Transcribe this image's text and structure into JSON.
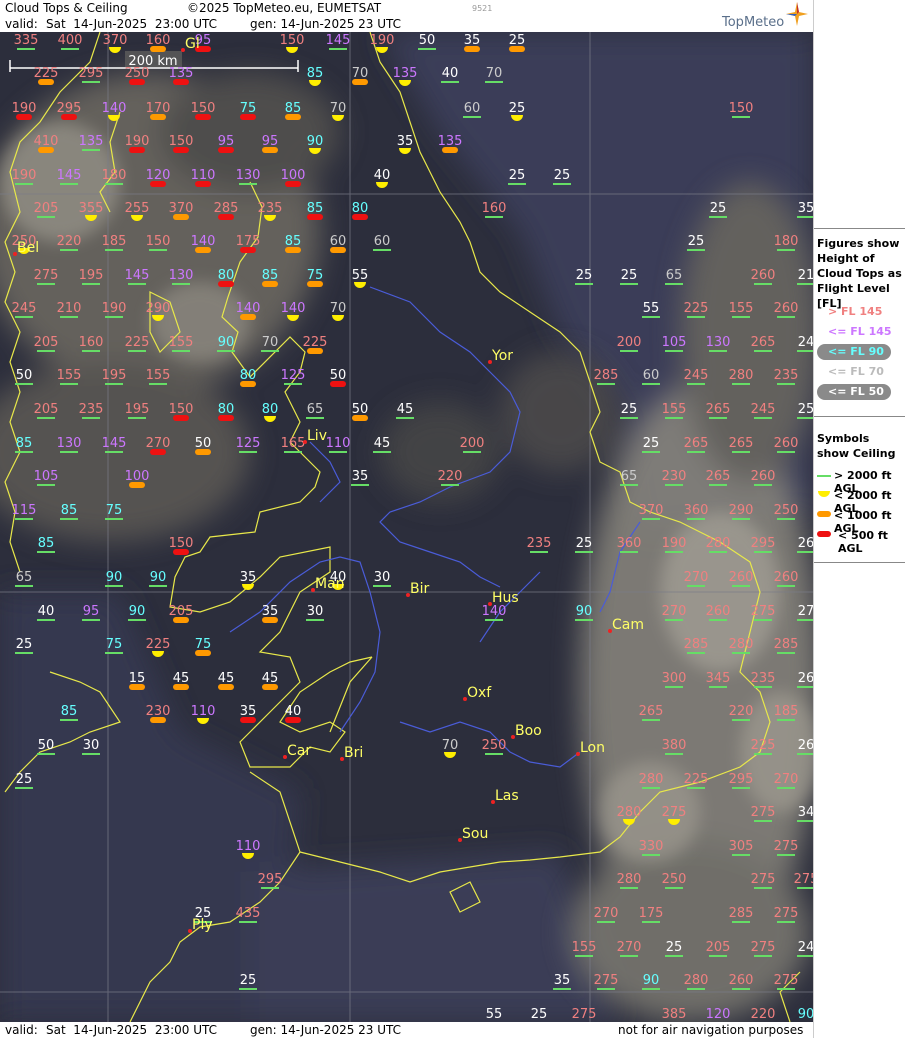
{
  "header": {
    "title": "Cloud Tops & Ceiling",
    "copyright": "©2025 TopMeteo.eu, EUMETSAT",
    "valid_label": "valid:",
    "valid_value": "Sat  14-Jun-2025  23:00 UTC",
    "gen_label": "gen: 14-Jun-2025 23 UTC",
    "tiny_id": "9521",
    "logo": "TopMeteo"
  },
  "footer": {
    "valid_label": "valid:",
    "valid_value": "Sat  14-Jun-2025  23:00 UTC",
    "gen_label": "gen: 14-Jun-2025 23 UTC",
    "disclaimer": "not for air navigation purposes"
  },
  "scale": {
    "label": "200 km"
  },
  "legend": {
    "tops_title": "Figures show Height of Cloud Tops as Flight Level  [FL]",
    "tops_items": [
      {
        "label": "> FL 145",
        "color": "#f08080"
      },
      {
        "label": "<= FL 145",
        "color": "#cc77ff"
      },
      {
        "label": "<= FL 90",
        "color": "#66ffff"
      },
      {
        "label": "<= FL 70",
        "color": "#bbbbbb"
      },
      {
        "label": "<= FL 50",
        "color": "#ffffff"
      }
    ],
    "ceiling_title": "Symbols show Ceiling",
    "ceiling_items": [
      {
        "label": "> 2000 ft AGL",
        "color": "#66dd66"
      },
      {
        "label": "< 2000 ft AGL",
        "color": "#ffee00"
      },
      {
        "label": "< 1000 ft AGL",
        "color": "#ff9900"
      },
      {
        "label": "< 500 ft AGL",
        "color": "#ee1111"
      }
    ]
  },
  "cities": [
    "Yor",
    "Liv",
    "Man",
    "Bir",
    "Hus",
    "Cam",
    "Oxf",
    "Boo",
    "Lon",
    "Car",
    "Bri",
    "Las",
    "Sou",
    "Ply",
    "Gl",
    "Bel"
  ],
  "stations": [
    {
      "v": "335",
      "t": "p",
      "c": "g"
    },
    {
      "v": "400",
      "t": "p",
      "c": "g"
    },
    {
      "v": "370",
      "t": "p",
      "c": "y"
    },
    {
      "v": "160",
      "t": "p",
      "c": "o"
    },
    {
      "v": "95",
      "t": "v",
      "c": "r"
    },
    {
      "v": "150",
      "t": "p",
      "c": "y"
    },
    {
      "v": "145",
      "t": "v",
      "c": "g"
    },
    {
      "v": "190",
      "t": "p",
      "c": "y"
    },
    {
      "v": "50",
      "t": "w",
      "c": "g"
    },
    {
      "v": "35",
      "t": "w",
      "c": "o"
    },
    {
      "v": "25",
      "t": "w",
      "c": "o"
    },
    {
      "v": "225",
      "t": "p",
      "c": "o"
    },
    {
      "v": "295",
      "t": "p",
      "c": "g"
    },
    {
      "v": "250",
      "t": "p",
      "c": "r"
    },
    {
      "v": "135",
      "t": "v",
      "c": "r"
    },
    {
      "v": "85",
      "t": "c",
      "c": "y"
    },
    {
      "v": "70",
      "t": "l",
      "c": "o"
    },
    {
      "v": "135",
      "t": "v",
      "c": "y"
    },
    {
      "v": "40",
      "t": "w",
      "c": "g"
    },
    {
      "v": "70",
      "t": "l",
      "c": "g"
    },
    {
      "v": "190",
      "t": "p",
      "c": "r"
    },
    {
      "v": "295",
      "t": "p",
      "c": "r"
    },
    {
      "v": "140",
      "t": "v",
      "c": "y"
    },
    {
      "v": "170",
      "t": "p",
      "c": "o"
    },
    {
      "v": "150",
      "t": "p",
      "c": "r"
    },
    {
      "v": "75",
      "t": "c",
      "c": "r"
    },
    {
      "v": "85",
      "t": "c",
      "c": "o"
    },
    {
      "v": "70",
      "t": "l",
      "c": "y"
    },
    {
      "v": "60",
      "t": "l",
      "c": "g"
    },
    {
      "v": "25",
      "t": "w",
      "c": "y"
    },
    {
      "v": "150",
      "t": "p",
      "c": "g"
    },
    {
      "v": "410",
      "t": "p",
      "c": "o"
    },
    {
      "v": "135",
      "t": "v",
      "c": "g"
    },
    {
      "v": "190",
      "t": "p",
      "c": "r"
    },
    {
      "v": "150",
      "t": "p",
      "c": "r"
    },
    {
      "v": "95",
      "t": "v",
      "c": "r"
    },
    {
      "v": "95",
      "t": "v",
      "c": "o"
    },
    {
      "v": "90",
      "t": "c",
      "c": "y"
    },
    {
      "v": "35",
      "t": "w",
      "c": "y"
    },
    {
      "v": "135",
      "t": "v",
      "c": "o"
    },
    {
      "v": "190",
      "t": "p",
      "c": "g"
    },
    {
      "v": "145",
      "t": "v",
      "c": "g"
    },
    {
      "v": "180",
      "t": "p",
      "c": "g"
    },
    {
      "v": "120",
      "t": "v",
      "c": "r"
    },
    {
      "v": "110",
      "t": "v",
      "c": "r"
    },
    {
      "v": "130",
      "t": "v",
      "c": "g"
    },
    {
      "v": "100",
      "t": "v",
      "c": "r"
    },
    {
      "v": "40",
      "t": "w",
      "c": "y"
    },
    {
      "v": "25",
      "t": "w",
      "c": "g"
    },
    {
      "v": "25",
      "t": "w",
      "c": "g"
    },
    {
      "v": "205",
      "t": "p",
      "c": "g"
    },
    {
      "v": "355",
      "t": "p",
      "c": "y"
    },
    {
      "v": "255",
      "t": "p",
      "c": "y"
    },
    {
      "v": "370",
      "t": "p",
      "c": "o"
    },
    {
      "v": "285",
      "t": "p",
      "c": "r"
    },
    {
      "v": "235",
      "t": "p",
      "c": "y"
    },
    {
      "v": "85",
      "t": "c",
      "c": "r"
    },
    {
      "v": "80",
      "t": "c",
      "c": "r"
    },
    {
      "v": "160",
      "t": "p",
      "c": "g"
    },
    {
      "v": "25",
      "t": "w",
      "c": "g"
    },
    {
      "v": "35",
      "t": "w",
      "c": "g"
    },
    {
      "v": "250",
      "t": "p",
      "c": "y"
    },
    {
      "v": "220",
      "t": "p",
      "c": "g"
    },
    {
      "v": "185",
      "t": "p",
      "c": "g"
    },
    {
      "v": "150",
      "t": "p",
      "c": "g"
    },
    {
      "v": "140",
      "t": "v",
      "c": "o"
    },
    {
      "v": "175",
      "t": "p",
      "c": "r"
    },
    {
      "v": "85",
      "t": "c",
      "c": "o"
    },
    {
      "v": "60",
      "t": "l",
      "c": "o"
    },
    {
      "v": "60",
      "t": "l",
      "c": "g"
    },
    {
      "v": "25",
      "t": "w",
      "c": "g"
    },
    {
      "v": "180",
      "t": "p",
      "c": "g"
    },
    {
      "v": "275",
      "t": "p",
      "c": "g"
    },
    {
      "v": "195",
      "t": "p",
      "c": "g"
    },
    {
      "v": "145",
      "t": "v",
      "c": "g"
    },
    {
      "v": "130",
      "t": "v",
      "c": "g"
    },
    {
      "v": "80",
      "t": "c",
      "c": "r"
    },
    {
      "v": "85",
      "t": "c",
      "c": "o"
    },
    {
      "v": "75",
      "t": "c",
      "c": "o"
    },
    {
      "v": "55",
      "t": "w",
      "c": "y"
    },
    {
      "v": "25",
      "t": "w",
      "c": "g"
    },
    {
      "v": "25",
      "t": "w",
      "c": "g"
    },
    {
      "v": "65",
      "t": "l",
      "c": "g"
    },
    {
      "v": "260",
      "t": "p",
      "c": "g"
    },
    {
      "v": "21",
      "t": "w",
      "c": "g"
    },
    {
      "v": "245",
      "t": "p",
      "c": "g"
    },
    {
      "v": "210",
      "t": "p",
      "c": "g"
    },
    {
      "v": "190",
      "t": "p",
      "c": "g"
    },
    {
      "v": "290",
      "t": "p",
      "c": "y"
    },
    {
      "v": "140",
      "t": "v",
      "c": "o"
    },
    {
      "v": "140",
      "t": "v",
      "c": "y"
    },
    {
      "v": "70",
      "t": "l",
      "c": "y"
    },
    {
      "v": "55",
      "t": "w",
      "c": "g"
    },
    {
      "v": "225",
      "t": "p",
      "c": "g"
    },
    {
      "v": "155",
      "t": "p",
      "c": "g"
    },
    {
      "v": "260",
      "t": "p",
      "c": "g"
    },
    {
      "v": "205",
      "t": "p",
      "c": "g"
    },
    {
      "v": "160",
      "t": "p",
      "c": "g"
    },
    {
      "v": "225",
      "t": "p",
      "c": "g"
    },
    {
      "v": "155",
      "t": "p",
      "c": "g"
    },
    {
      "v": "90",
      "t": "c",
      "c": "g"
    },
    {
      "v": "70",
      "t": "l",
      "c": "g"
    },
    {
      "v": "225",
      "t": "p",
      "c": "o"
    },
    {
      "v": "200",
      "t": "p",
      "c": "g"
    },
    {
      "v": "105",
      "t": "v",
      "c": "g"
    },
    {
      "v": "130",
      "t": "v",
      "c": "g"
    },
    {
      "v": "265",
      "t": "p",
      "c": "g"
    },
    {
      "v": "24",
      "t": "w",
      "c": "g"
    },
    {
      "v": "50",
      "t": "w",
      "c": "g"
    },
    {
      "v": "155",
      "t": "p",
      "c": "g"
    },
    {
      "v": "195",
      "t": "p",
      "c": "g"
    },
    {
      "v": "155",
      "t": "p",
      "c": "g"
    },
    {
      "v": "80",
      "t": "c",
      "c": "o"
    },
    {
      "v": "125",
      "t": "v",
      "c": "g"
    },
    {
      "v": "50",
      "t": "w",
      "c": "r"
    },
    {
      "v": "285",
      "t": "p",
      "c": "g"
    },
    {
      "v": "60",
      "t": "l",
      "c": "g"
    },
    {
      "v": "245",
      "t": "p",
      "c": "g"
    },
    {
      "v": "280",
      "t": "p",
      "c": "g"
    },
    {
      "v": "235",
      "t": "p",
      "c": "g"
    },
    {
      "v": "205",
      "t": "p",
      "c": "g"
    },
    {
      "v": "235",
      "t": "p",
      "c": "g"
    },
    {
      "v": "195",
      "t": "p",
      "c": "g"
    },
    {
      "v": "150",
      "t": "p",
      "c": "r"
    },
    {
      "v": "80",
      "t": "c",
      "c": "r"
    },
    {
      "v": "80",
      "t": "c",
      "c": "y"
    },
    {
      "v": "65",
      "t": "l",
      "c": "g"
    },
    {
      "v": "50",
      "t": "w",
      "c": "o"
    },
    {
      "v": "45",
      "t": "w",
      "c": "g"
    },
    {
      "v": "25",
      "t": "w",
      "c": "g"
    },
    {
      "v": "155",
      "t": "p",
      "c": "g"
    },
    {
      "v": "265",
      "t": "p",
      "c": "g"
    },
    {
      "v": "245",
      "t": "p",
      "c": "g"
    },
    {
      "v": "25",
      "t": "w",
      "c": "g"
    },
    {
      "v": "85",
      "t": "c",
      "c": "g"
    },
    {
      "v": "130",
      "t": "v",
      "c": "g"
    },
    {
      "v": "145",
      "t": "v",
      "c": "g"
    },
    {
      "v": "270",
      "t": "p",
      "c": "r"
    },
    {
      "v": "50",
      "t": "w",
      "c": "o"
    },
    {
      "v": "125",
      "t": "v",
      "c": "g"
    },
    {
      "v": "165",
      "t": "p",
      "c": "g"
    },
    {
      "v": "110",
      "t": "v",
      "c": "g"
    },
    {
      "v": "45",
      "t": "w",
      "c": "g"
    },
    {
      "v": "200",
      "t": "p",
      "c": "g"
    },
    {
      "v": "25",
      "t": "w",
      "c": "g"
    },
    {
      "v": "265",
      "t": "p",
      "c": "g"
    },
    {
      "v": "265",
      "t": "p",
      "c": "g"
    },
    {
      "v": "260",
      "t": "p",
      "c": "g"
    },
    {
      "v": "105",
      "t": "v",
      "c": "g"
    },
    {
      "v": "100",
      "t": "v",
      "c": "o"
    },
    {
      "v": "35",
      "t": "w",
      "c": "g"
    },
    {
      "v": "220",
      "t": "p",
      "c": "g"
    },
    {
      "v": "65",
      "t": "l",
      "c": "g"
    },
    {
      "v": "230",
      "t": "p",
      "c": "g"
    },
    {
      "v": "265",
      "t": "p",
      "c": "g"
    },
    {
      "v": "260",
      "t": "p",
      "c": "g"
    },
    {
      "v": "115",
      "t": "v",
      "c": "g"
    },
    {
      "v": "85",
      "t": "c",
      "c": "g"
    },
    {
      "v": "75",
      "t": "c",
      "c": "g"
    },
    {
      "v": "370",
      "t": "p",
      "c": "g"
    },
    {
      "v": "360",
      "t": "p",
      "c": "g"
    },
    {
      "v": "290",
      "t": "p",
      "c": "g"
    },
    {
      "v": "250",
      "t": "p",
      "c": "g"
    },
    {
      "v": "85",
      "t": "c",
      "c": "g"
    },
    {
      "v": "150",
      "t": "p",
      "c": "r"
    },
    {
      "v": "235",
      "t": "p",
      "c": "g"
    },
    {
      "v": "25",
      "t": "w",
      "c": "g"
    },
    {
      "v": "360",
      "t": "p",
      "c": "g"
    },
    {
      "v": "190",
      "t": "p",
      "c": "g"
    },
    {
      "v": "280",
      "t": "p",
      "c": "g"
    },
    {
      "v": "295",
      "t": "p",
      "c": "g"
    },
    {
      "v": "26",
      "t": "w",
      "c": "g"
    },
    {
      "v": "65",
      "t": "l",
      "c": "g"
    },
    {
      "v": "90",
      "t": "c",
      "c": "g"
    },
    {
      "v": "90",
      "t": "c",
      "c": "g"
    },
    {
      "v": "35",
      "t": "w",
      "c": "y"
    },
    {
      "v": "40",
      "t": "w",
      "c": "y"
    },
    {
      "v": "30",
      "t": "w",
      "c": "g"
    },
    {
      "v": "270",
      "t": "p",
      "c": "g"
    },
    {
      "v": "260",
      "t": "p",
      "c": "g"
    },
    {
      "v": "260",
      "t": "p",
      "c": "g"
    },
    {
      "v": "40",
      "t": "w",
      "c": "g"
    },
    {
      "v": "95",
      "t": "v",
      "c": "g"
    },
    {
      "v": "90",
      "t": "c",
      "c": "g"
    },
    {
      "v": "205",
      "t": "p",
      "c": "o"
    },
    {
      "v": "35",
      "t": "w",
      "c": "o"
    },
    {
      "v": "30",
      "t": "w",
      "c": "g"
    },
    {
      "v": "140",
      "t": "v",
      "c": "g"
    },
    {
      "v": "90",
      "t": "c",
      "c": "g"
    },
    {
      "v": "270",
      "t": "p",
      "c": "g"
    },
    {
      "v": "260",
      "t": "p",
      "c": "g"
    },
    {
      "v": "275",
      "t": "p",
      "c": "g"
    },
    {
      "v": "27",
      "t": "w",
      "c": "g"
    },
    {
      "v": "25",
      "t": "w",
      "c": "g"
    },
    {
      "v": "75",
      "t": "c",
      "c": "g"
    },
    {
      "v": "225",
      "t": "p",
      "c": "y"
    },
    {
      "v": "75",
      "t": "c",
      "c": "o"
    },
    {
      "v": "285",
      "t": "p",
      "c": "g"
    },
    {
      "v": "280",
      "t": "p",
      "c": "g"
    },
    {
      "v": "285",
      "t": "p",
      "c": "g"
    },
    {
      "v": "15",
      "t": "w",
      "c": "o"
    },
    {
      "v": "45",
      "t": "w",
      "c": "o"
    },
    {
      "v": "45",
      "t": "w",
      "c": "o"
    },
    {
      "v": "45",
      "t": "w",
      "c": "o"
    },
    {
      "v": "300",
      "t": "p",
      "c": "g"
    },
    {
      "v": "345",
      "t": "p",
      "c": "g"
    },
    {
      "v": "235",
      "t": "p",
      "c": "g"
    },
    {
      "v": "26",
      "t": "w",
      "c": "g"
    },
    {
      "v": "85",
      "t": "c",
      "c": "g"
    },
    {
      "v": "230",
      "t": "p",
      "c": "o"
    },
    {
      "v": "110",
      "t": "v",
      "c": "y"
    },
    {
      "v": "35",
      "t": "w",
      "c": "r"
    },
    {
      "v": "40",
      "t": "w",
      "c": "r"
    },
    {
      "v": "265",
      "t": "p",
      "c": "g"
    },
    {
      "v": "220",
      "t": "p",
      "c": "g"
    },
    {
      "v": "185",
      "t": "p",
      "c": "g"
    },
    {
      "v": "50",
      "t": "w",
      "c": "g"
    },
    {
      "v": "30",
      "t": "w",
      "c": "g"
    },
    {
      "v": "70",
      "t": "l",
      "c": "y"
    },
    {
      "v": "250",
      "t": "p",
      "c": "g"
    },
    {
      "v": "380",
      "t": "p",
      "c": "g"
    },
    {
      "v": "225",
      "t": "p",
      "c": "g"
    },
    {
      "v": "26",
      "t": "w",
      "c": "g"
    },
    {
      "v": "25",
      "t": "w",
      "c": "g"
    },
    {
      "v": "280",
      "t": "p",
      "c": "g"
    },
    {
      "v": "225",
      "t": "p",
      "c": "g"
    },
    {
      "v": "295",
      "t": "p",
      "c": "g"
    },
    {
      "v": "270",
      "t": "p",
      "c": "g"
    },
    {
      "v": "280",
      "t": "p",
      "c": "y"
    },
    {
      "v": "275",
      "t": "p",
      "c": "y"
    },
    {
      "v": "275",
      "t": "p",
      "c": "g"
    },
    {
      "v": "34",
      "t": "w",
      "c": "g"
    },
    {
      "v": "110",
      "t": "v",
      "c": "y"
    },
    {
      "v": "330",
      "t": "p",
      "c": "g"
    },
    {
      "v": "305",
      "t": "p",
      "c": "g"
    },
    {
      "v": "275",
      "t": "p",
      "c": "g"
    },
    {
      "v": "295",
      "t": "p",
      "c": "g"
    },
    {
      "v": "280",
      "t": "p",
      "c": "g"
    },
    {
      "v": "250",
      "t": "p",
      "c": "g"
    },
    {
      "v": "275",
      "t": "p",
      "c": "g"
    },
    {
      "v": "275",
      "t": "p",
      "c": "g"
    },
    {
      "v": "25",
      "t": "w",
      "c": "g"
    },
    {
      "v": "435",
      "t": "p",
      "c": "g"
    },
    {
      "v": "270",
      "t": "p",
      "c": "g"
    },
    {
      "v": "175",
      "t": "p",
      "c": "g"
    },
    {
      "v": "285",
      "t": "p",
      "c": "g"
    },
    {
      "v": "275",
      "t": "p",
      "c": "g"
    },
    {
      "v": "155",
      "t": "p",
      "c": "g"
    },
    {
      "v": "270",
      "t": "p",
      "c": "g"
    },
    {
      "v": "25",
      "t": "w",
      "c": "g"
    },
    {
      "v": "205",
      "t": "p",
      "c": "g"
    },
    {
      "v": "275",
      "t": "p",
      "c": "g"
    },
    {
      "v": "24",
      "t": "w",
      "c": "g"
    },
    {
      "v": "25",
      "t": "w",
      "c": "g"
    },
    {
      "v": "35",
      "t": "w",
      "c": "g"
    },
    {
      "v": "275",
      "t": "p",
      "c": "g"
    },
    {
      "v": "90",
      "t": "c",
      "c": "g"
    },
    {
      "v": "280",
      "t": "p",
      "c": "g"
    },
    {
      "v": "260",
      "t": "p",
      "c": "g"
    },
    {
      "v": "275",
      "t": "p",
      "c": "g"
    },
    {
      "v": "55",
      "t": "w",
      "c": "g"
    },
    {
      "v": "25",
      "t": "w",
      "c": "g"
    },
    {
      "v": "275",
      "t": "p",
      "c": "g"
    },
    {
      "v": "385",
      "t": "p",
      "c": "g"
    },
    {
      "v": "120",
      "t": "v",
      "c": "g"
    },
    {
      "v": "220",
      "t": "p",
      "c": "g"
    },
    {
      "v": "90",
      "t": "c",
      "c": "g"
    }
  ]
}
